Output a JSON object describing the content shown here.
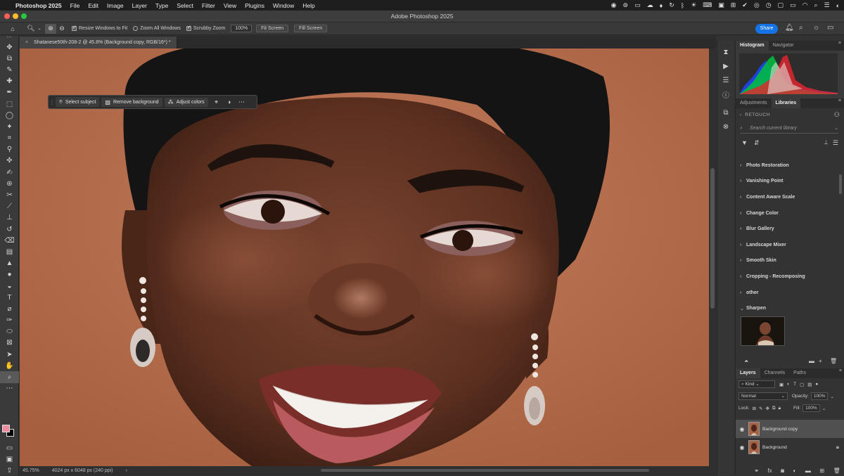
{
  "menubar": {
    "app_name": "Photoshop 2025",
    "items": [
      "File",
      "Edit",
      "Image",
      "Layer",
      "Type",
      "Select",
      "Filter",
      "View",
      "Plugins",
      "Window",
      "Help"
    ]
  },
  "window": {
    "title": "Adobe Photoshop 2025"
  },
  "options": {
    "resize_windows": "Resize Windows to Fit",
    "zoom_all_windows": "Zoom All Windows",
    "scrubby_zoom": "Scrubby Zoom",
    "zoom_value": "100%",
    "fit_screen": "Fit Screen",
    "fill_screen": "Fill Screen",
    "share": "Share"
  },
  "document": {
    "tab_title": "Shatanese50th-208-2 @ 45.8% (Background copy, RGB/16*) *"
  },
  "taskbar": {
    "select_subject": "Select subject",
    "remove_background": "Remove background",
    "adjust_colors": "Adjust colors"
  },
  "statusbar": {
    "zoom": "45.75%",
    "doc_info": "4024 px x 6048 px (240 ppi)"
  },
  "histogram_panel": {
    "tabs": [
      "Histogram",
      "Navigator"
    ]
  },
  "libraries_panel": {
    "tabs": [
      "Adjustments",
      "Libraries"
    ],
    "library_name": "RETOUCH",
    "search_placeholder": "Search current library",
    "groups": [
      "Photo Restoration",
      "Vanishing Point",
      "Content Aware Scale",
      "Change Color",
      "Blur Gallery",
      "Landscape Mixer",
      "Smooth Skin",
      "Cropping - Recomposing",
      "other",
      "Sharpen"
    ]
  },
  "layers_panel": {
    "tabs": [
      "Layers",
      "Channels",
      "Paths"
    ],
    "filter_label": "Kind",
    "blend_mode": "Normal",
    "opacity_label": "Opacity:",
    "opacity_value": "100%",
    "lock_label": "Lock:",
    "fill_label": "Fill:",
    "fill_value": "100%",
    "layers": [
      {
        "name": "Background copy",
        "selected": true,
        "locked": false
      },
      {
        "name": "Background",
        "selected": false,
        "locked": true
      }
    ]
  },
  "colors": {
    "accent": "#1473e6",
    "foreground_swatch": "#f08aa0",
    "background_swatch": "#000000",
    "canvas_bg": "#b97052"
  }
}
